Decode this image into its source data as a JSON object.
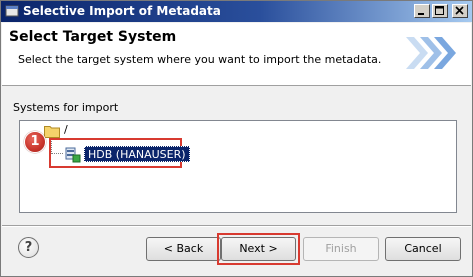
{
  "window": {
    "title": "Selective Import of Metadata",
    "icon": "import-wizard-icon"
  },
  "titlebar_buttons": {
    "minimize_icon": "minimize-icon",
    "maximize_icon": "maximize-icon",
    "close_icon": "close-icon"
  },
  "header": {
    "title": "Select Target System",
    "description": "Select the target system where you want to import the metadata.",
    "graphic": "wizard-chevrons-graphic"
  },
  "systems": {
    "label": "Systems for import",
    "root_label": "/",
    "root_icon": "folder-icon",
    "items": [
      {
        "label": "HDB (HANAUSER)",
        "icon": "database-system-icon",
        "selected": true
      }
    ]
  },
  "callout": {
    "number": "1"
  },
  "footer": {
    "help_label": "?",
    "back_label": "< Back",
    "next_label": "Next >",
    "finish_label": "Finish",
    "cancel_label": "Cancel"
  },
  "colors": {
    "titlebar_start": "#0a246a",
    "titlebar_end": "#a6caf0",
    "highlight_red": "#d83a30",
    "selection_blue": "#0a246a"
  }
}
